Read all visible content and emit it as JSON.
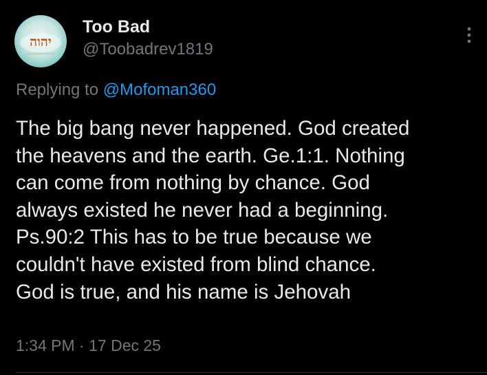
{
  "author": {
    "display_name": "Too Bad",
    "handle": "@Toobadrev1819",
    "avatar_text": "יהוה"
  },
  "reply": {
    "prefix": "Replying to ",
    "mention": "@Mofoman360"
  },
  "tweet": {
    "lines": [
      "The big bang never happened. God created",
      "the heavens and the earth. Ge.1:1. Nothing",
      "can come from nothing by chance. God",
      "always existed he never had a beginning.",
      "Ps.90:2 This has to be true because we",
      "couldn't have existed from blind chance.",
      "God is true, and his name is Jehovah"
    ]
  },
  "meta": {
    "time": "1:34 PM",
    "separator": " · ",
    "date": "17 Dec 25"
  },
  "icons": {
    "more": "more-vertical-icon"
  },
  "colors": {
    "background": "#000000",
    "primary_text": "#e7e9ea",
    "secondary_text": "#71767b",
    "link": "#1d9bf0",
    "avatar_text": "#c0521c"
  }
}
